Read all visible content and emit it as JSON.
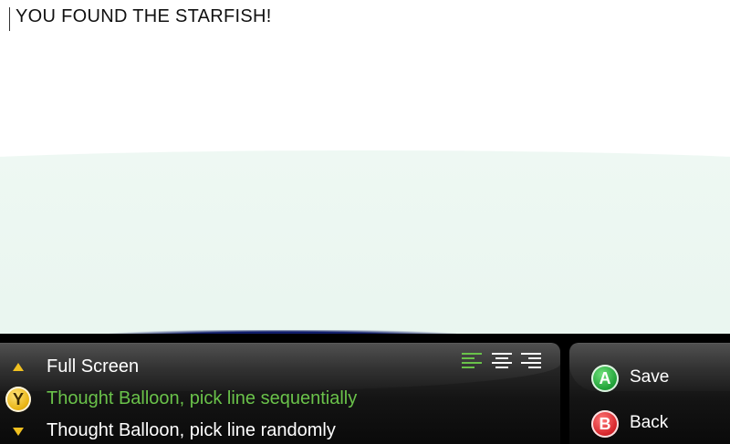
{
  "editor": {
    "text": "YOU FOUND THE STARFISH!"
  },
  "options": {
    "items": [
      {
        "label": "Full Screen",
        "indicator": "arrow-up-icon"
      },
      {
        "label": "Thought Balloon, pick line sequentially",
        "indicator": "y-button-icon",
        "button_glyph": "Y",
        "selected": true
      },
      {
        "label": "Thought Balloon, pick line randomly",
        "indicator": "arrow-down-icon"
      }
    ],
    "selected_color": "#6ac24a"
  },
  "alignment": {
    "options": [
      "left",
      "center",
      "right"
    ],
    "selected": "left"
  },
  "actions": {
    "save": {
      "button_glyph": "A",
      "label": "Save",
      "color": "#22a33a"
    },
    "back": {
      "button_glyph": "B",
      "label": "Back",
      "color": "#d8262c"
    }
  }
}
